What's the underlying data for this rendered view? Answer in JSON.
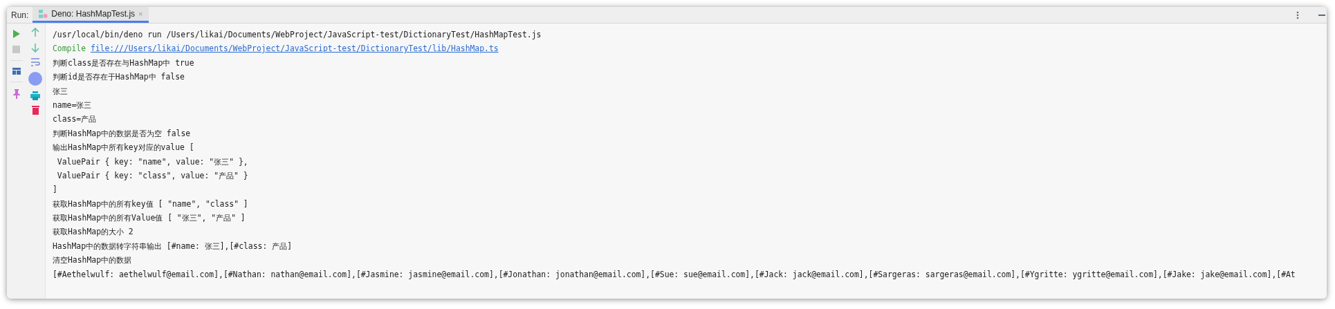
{
  "run_label": "Run:",
  "tabs": [
    {
      "label": "Deno: HashMapTest.js",
      "selected": true,
      "close": "×"
    }
  ],
  "console": [
    {
      "kind": "text",
      "text": "/usr/local/bin/deno run /Users/likai/Documents/WebProject/JavaScript-test/DictionaryTest/HashMapTest.js"
    },
    {
      "kind": "compile",
      "prefix": "Compile",
      "link": "file:///Users/likai/Documents/WebProject/JavaScript-test/DictionaryTest/lib/HashMap.ts"
    },
    {
      "kind": "text",
      "text": "判断class是否存在与HashMap中 true"
    },
    {
      "kind": "text",
      "text": "判断id是否存在于HashMap中 false"
    },
    {
      "kind": "text",
      "text": "张三"
    },
    {
      "kind": "text",
      "text": "name=张三"
    },
    {
      "kind": "text",
      "text": "class=产品"
    },
    {
      "kind": "text",
      "text": "判断HashMap中的数据是否为空 false"
    },
    {
      "kind": "text",
      "text": "输出HashMap中所有key对应的value ["
    },
    {
      "kind": "text",
      "text": " ValuePair { key: \"name\", value: \"张三\" },"
    },
    {
      "kind": "text",
      "text": " ValuePair { key: \"class\", value: \"产品\" }"
    },
    {
      "kind": "text",
      "text": "]"
    },
    {
      "kind": "text",
      "text": "获取HashMap中的所有key值 [ \"name\", \"class\" ]"
    },
    {
      "kind": "text",
      "text": "获取HashMap中的所有Value值 [ \"张三\", \"产品\" ]"
    },
    {
      "kind": "text",
      "text": "获取HashMap的大小 2"
    },
    {
      "kind": "text",
      "text": "HashMap中的数据转字符串输出 [#name: 张三],[#class: 产品]"
    },
    {
      "kind": "text",
      "text": "清空HashMap中的数据"
    },
    {
      "kind": "text",
      "text": "[#Aethelwulf: aethelwulf@email.com],[#Nathan: nathan@email.com],[#Jasmine: jasmine@email.com],[#Jonathan: jonathan@email.com],[#Sue: sue@email.com],[#Jack: jack@email.com],[#Sargeras: sargeras@email.com],[#Ygritte: ygritte@email.com],[#Jake: jake@email.com],[#At"
    }
  ]
}
